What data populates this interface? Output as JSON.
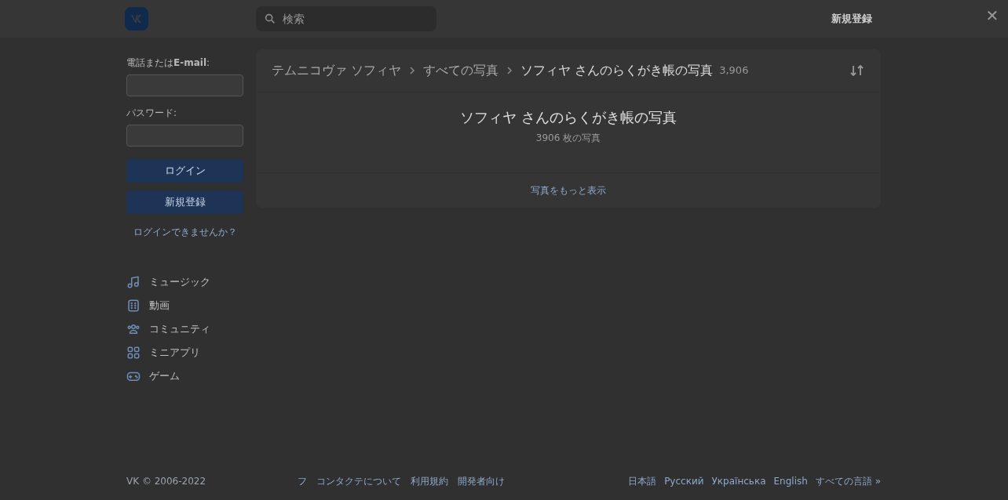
{
  "header": {
    "search": {
      "placeholder": "検索"
    },
    "signup_link": "新規登録"
  },
  "close": "✕",
  "login": {
    "phone_label": "電話または**E-mail**:",
    "password_label": "パスワード:",
    "login_button": "ログイン",
    "signup_button": "新規登録",
    "forgot_link": "ログインできませんか？"
  },
  "menu": [
    {
      "kind": "music",
      "label": "ミュージック"
    },
    {
      "kind": "video",
      "label": "動画"
    },
    {
      "kind": "community",
      "label": "コミュニティ"
    },
    {
      "kind": "apps",
      "label": "ミニアプリ"
    },
    {
      "kind": "games",
      "label": "ゲーム"
    }
  ],
  "breadcrumbs": [
    "テムニコヴァ ソフィヤ",
    "すべての写真",
    "ソフィヤ さんのらくがき帳の写真"
  ],
  "breadcrumb_count": "3,906",
  "album": {
    "title": "ソフィヤ さんのらくがき帳の写真",
    "subtitle": "3906 枚の写真",
    "more_link": "写真をもっと表示"
  },
  "footer": {
    "copyright": "VK © 2006-2022",
    "links": [
      "フ",
      "コンタクテについて",
      "利用規約",
      "開発者向け"
    ],
    "languages": [
      "日本語",
      "Русский",
      "Українська",
      "English",
      "すべての言語 »"
    ]
  }
}
